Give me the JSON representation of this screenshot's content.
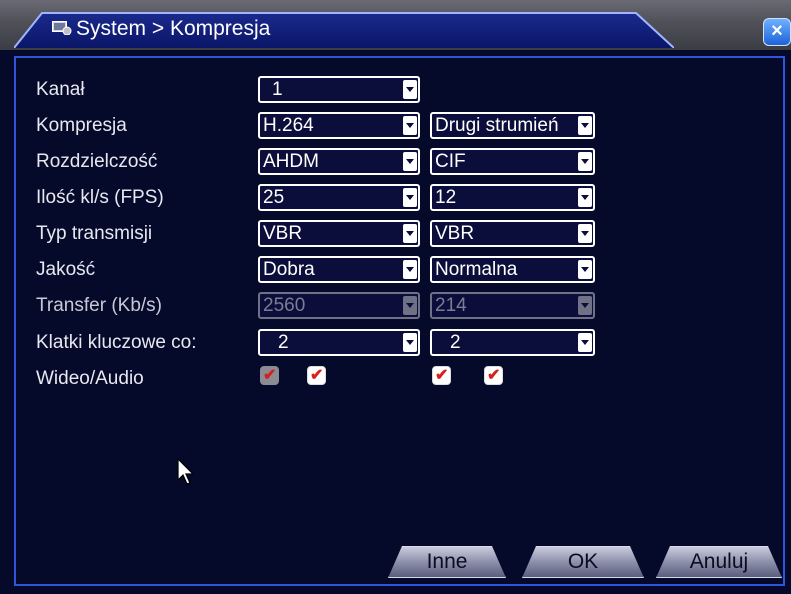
{
  "window": {
    "title": "System > Kompresja",
    "close_label": "×"
  },
  "form": {
    "rows": [
      {
        "label": "Kanał",
        "main": "1",
        "extra": ""
      },
      {
        "label": "Kompresja",
        "main": "H.264",
        "extra": "Drugi strumień"
      },
      {
        "label": "Rozdzielczość",
        "main": "AHDM",
        "extra": "CIF"
      },
      {
        "label": "Ilość kl/s (FPS)",
        "main": "25",
        "extra": "12"
      },
      {
        "label": "Typ transmisji",
        "main": "VBR",
        "extra": "VBR"
      },
      {
        "label": "Jakość",
        "main": "Dobra",
        "extra": "Normalna"
      },
      {
        "label": "Transfer (Kb/s)",
        "main": "2560",
        "extra": "214"
      },
      {
        "label": "Klatki kluczowe co:",
        "main": "2",
        "extra": "2"
      },
      {
        "label": "Wideo/Audio"
      }
    ],
    "checkbox_mark": "✔"
  },
  "buttons": {
    "other": "Inne",
    "ok": "OK",
    "cancel": "Anuluj"
  },
  "colors": {
    "background": "#050a2a",
    "frame_border": "#2f55d8",
    "title_tab": "#1b2a8e",
    "check_mark": "#d91e1e"
  },
  "icons": {
    "title": "system-settings-icon",
    "close": "close-icon",
    "dropdown": "chevron-down-icon",
    "pointer": "mouse-cursor-icon"
  }
}
